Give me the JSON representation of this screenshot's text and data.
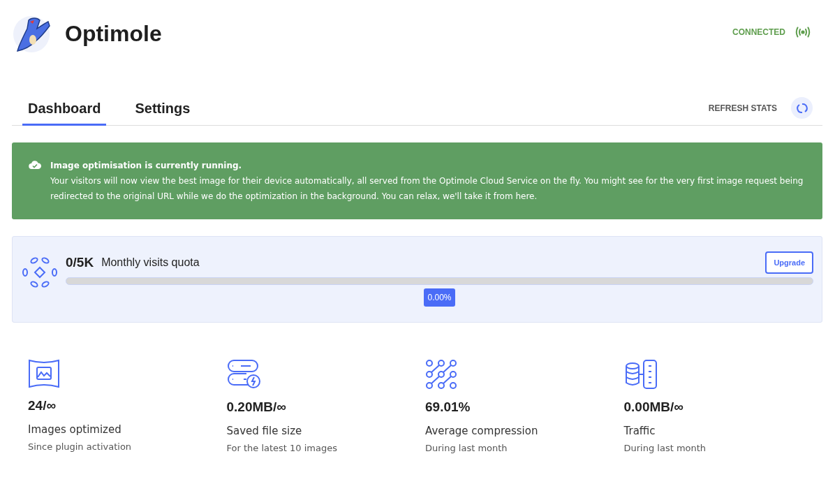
{
  "app": {
    "title": "Optimole",
    "connection": {
      "label": "CONNECTED",
      "connected": true
    }
  },
  "tabs": [
    {
      "label": "Dashboard",
      "selected": true
    },
    {
      "label": "Settings",
      "selected": false
    }
  ],
  "refresh": {
    "label": "REFRESH STATS"
  },
  "notice": {
    "title": "Image optimisation is currently running.",
    "text": "Your visitors will now view the best image for their device automatically, all served from the Optimole Cloud Service on the fly. You might see for the very first image request being redirected to the original URL while we do the optimization in the background. You can relax, we'll take it from here."
  },
  "quota": {
    "value": "0/5K",
    "label": "Monthly visits quota",
    "button": "Upgrade",
    "level": 0,
    "reading": "0.00%"
  },
  "stats": [
    {
      "kind": "images",
      "value": "24/∞",
      "label": "Images optimized",
      "note": "Since plugin activation"
    },
    {
      "kind": "saved",
      "value": "0.20MB/∞",
      "label": "Saved file size",
      "note": "For the latest 10 images"
    },
    {
      "kind": "compression",
      "value": "69.01%",
      "label": "Average compression",
      "note": "During last month"
    },
    {
      "kind": "traffic",
      "value": "0.00MB/∞",
      "label": "Traffic",
      "note": "During last month"
    }
  ]
}
